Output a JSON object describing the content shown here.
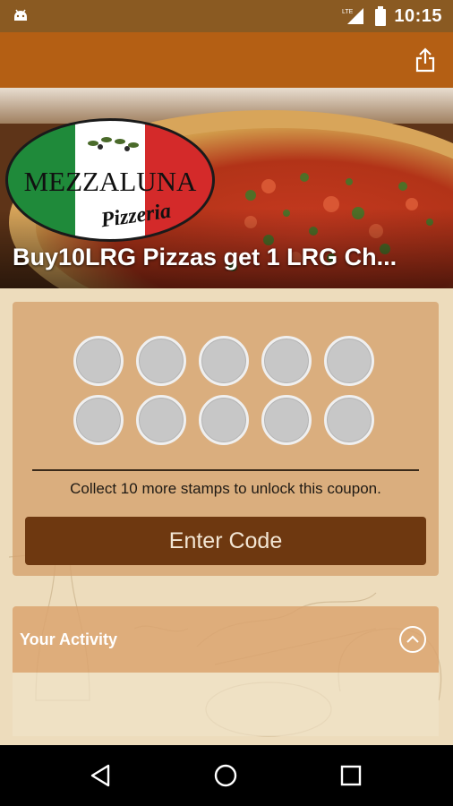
{
  "status_bar": {
    "network_label": "LTE",
    "time": "10:15",
    "icons": [
      "android-icon",
      "signal-icon",
      "battery-icon"
    ]
  },
  "app_bar": {
    "actions": [
      "share-icon"
    ]
  },
  "hero": {
    "logo_text_main": "MEZZALUNA",
    "logo_text_sub": "Pizzeria",
    "title": "Buy10LRG Pizzas get 1 LRG Ch..."
  },
  "stamp_card": {
    "stamps_total": 10,
    "stamps_collected": 0,
    "message": "Collect 10 more stamps to unlock this coupon.",
    "button_label": "Enter Code"
  },
  "activity": {
    "title": "Your Activity",
    "expanded": true
  },
  "nav_bar": {
    "buttons": [
      "back-icon",
      "home-icon",
      "recents-icon"
    ]
  },
  "colors": {
    "status_bar": "#8a5a22",
    "app_bar": "#b45f14",
    "button": "#6e3810",
    "card": "#d6a370"
  }
}
